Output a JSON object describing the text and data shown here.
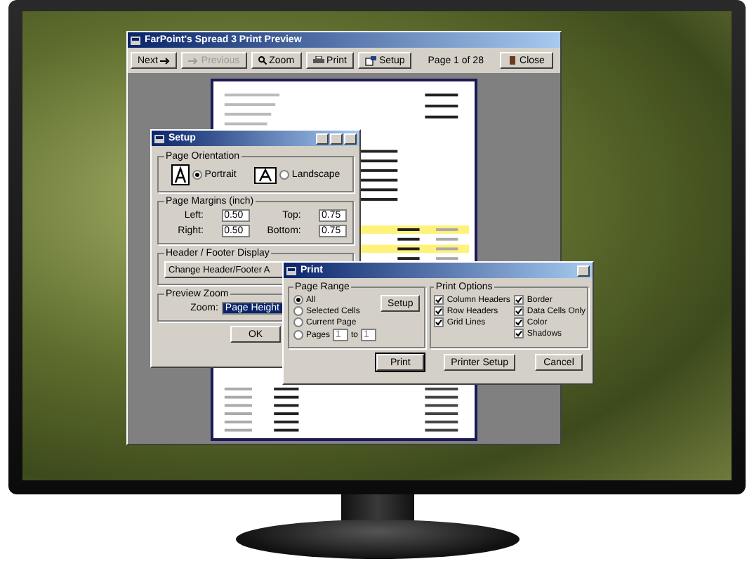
{
  "preview": {
    "title": "FarPoint's Spread 3 Print Preview",
    "toolbar": [
      {
        "label": "Next",
        "disabled": false
      },
      {
        "label": "Previous",
        "disabled": true
      },
      {
        "label": "Zoom",
        "disabled": false
      },
      {
        "label": "Print",
        "disabled": false
      },
      {
        "label": "Setup",
        "disabled": false
      }
    ],
    "page_indicator": "Page 1 of 28",
    "close_label": "Close"
  },
  "setup": {
    "title": "Setup",
    "orientation": {
      "title": "Page Orientation",
      "options": [
        {
          "label": "Portrait",
          "selected": true
        },
        {
          "label": "Landscape",
          "selected": false
        }
      ]
    },
    "margins": {
      "title": "Page Margins (inch)",
      "fields": [
        {
          "label": "Left:",
          "value": "0.50"
        },
        {
          "label": "Top:",
          "value": "0.75"
        },
        {
          "label": "Right:",
          "value": "0.50"
        },
        {
          "label": "Bottom:",
          "value": "0.75"
        }
      ]
    },
    "header_footer": {
      "title": "Header / Footer Display",
      "button": "Change Header/Footer A"
    },
    "zoom": {
      "title": "Preview Zoom",
      "label": "Zoom:",
      "value": "Page Height"
    },
    "ok": "OK"
  },
  "print": {
    "title": "Print",
    "page_range": {
      "title": "Page Range",
      "options": [
        {
          "label": "All",
          "selected": true
        },
        {
          "label": "Selected Cells",
          "selected": false
        },
        {
          "label": "Current Page",
          "selected": false
        },
        {
          "label": "Pages",
          "selected": false
        }
      ],
      "from": "1",
      "to_label": "to",
      "to": "1",
      "setup_button": "Setup"
    },
    "print_options": {
      "title": "Print Options",
      "checkboxes": [
        {
          "label": "Column Headers",
          "checked": true
        },
        {
          "label": "Border",
          "checked": true
        },
        {
          "label": "Row Headers",
          "checked": true
        },
        {
          "label": "Data Cells Only",
          "checked": true
        },
        {
          "label": "Grid Lines",
          "checked": true
        },
        {
          "label": "Color",
          "checked": true
        },
        {
          "label": "Shadows",
          "checked": true
        }
      ]
    },
    "buttons": [
      "Print",
      "Printer Setup",
      "Cancel"
    ]
  }
}
